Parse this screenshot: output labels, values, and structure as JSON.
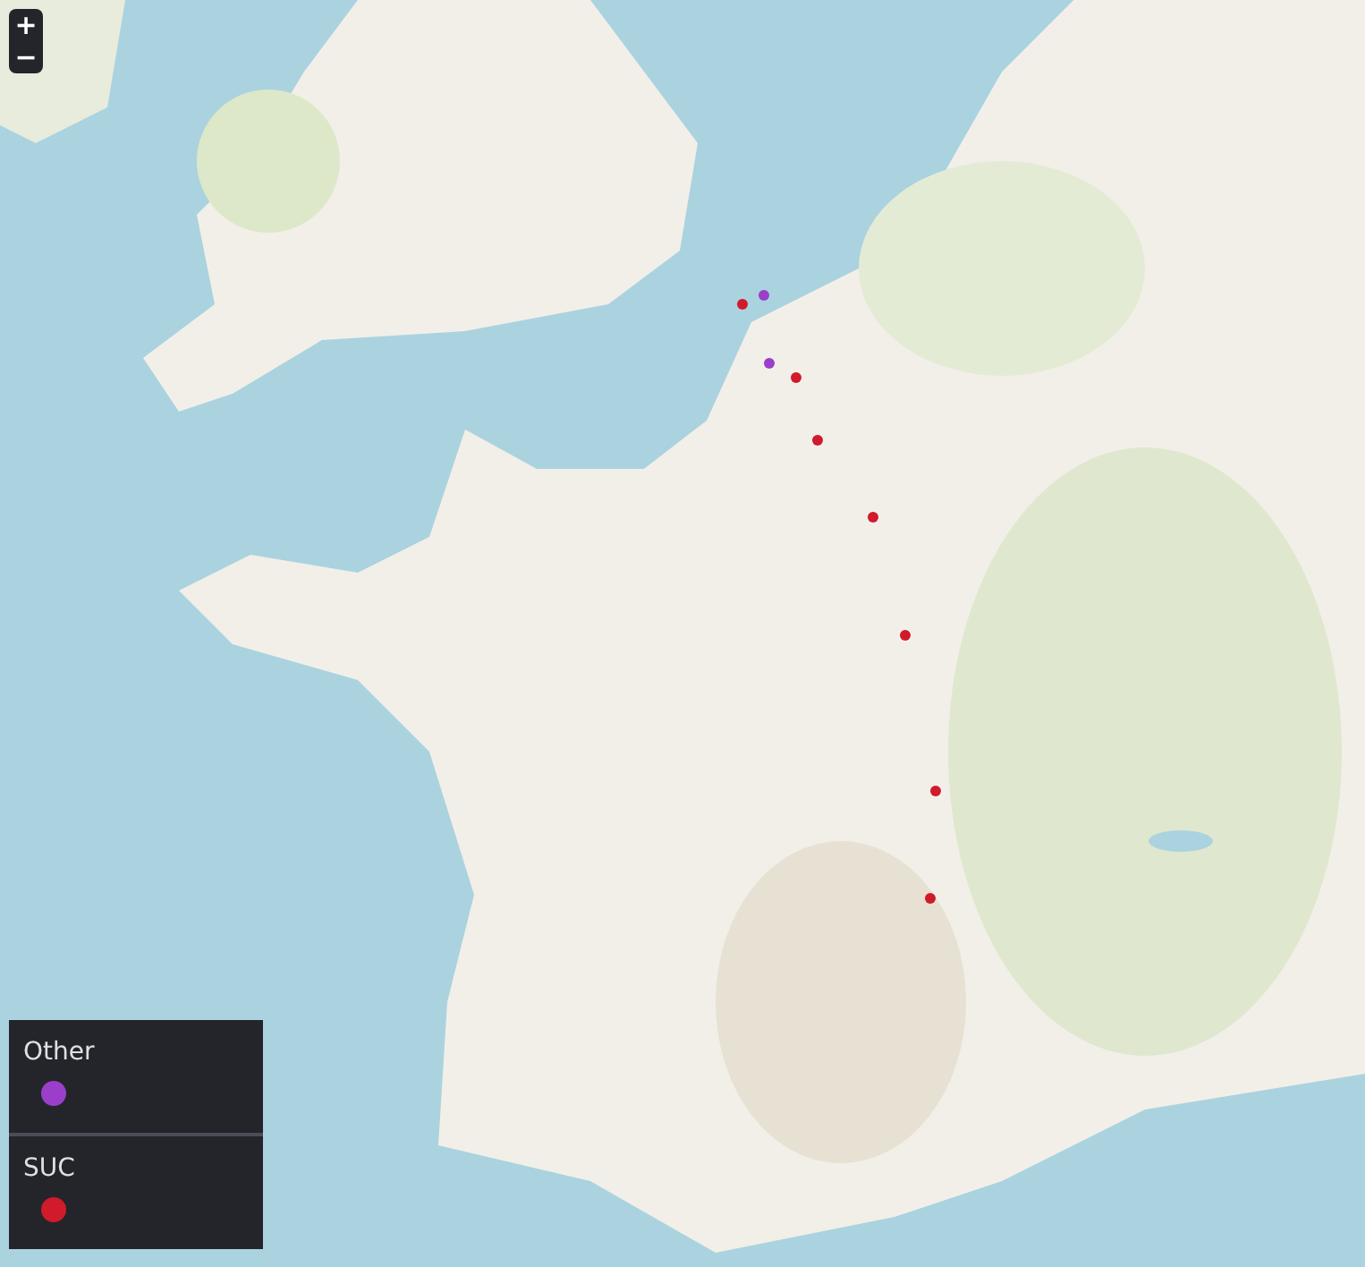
{
  "zoom_controls": [
    {
      "label": "+"
    },
    {
      "label": "−"
    }
  ],
  "legend": [
    {
      "label": "Other",
      "color": "#9b3fcb"
    },
    {
      "label": "SUC",
      "color": "#d11a2a"
    }
  ]
}
